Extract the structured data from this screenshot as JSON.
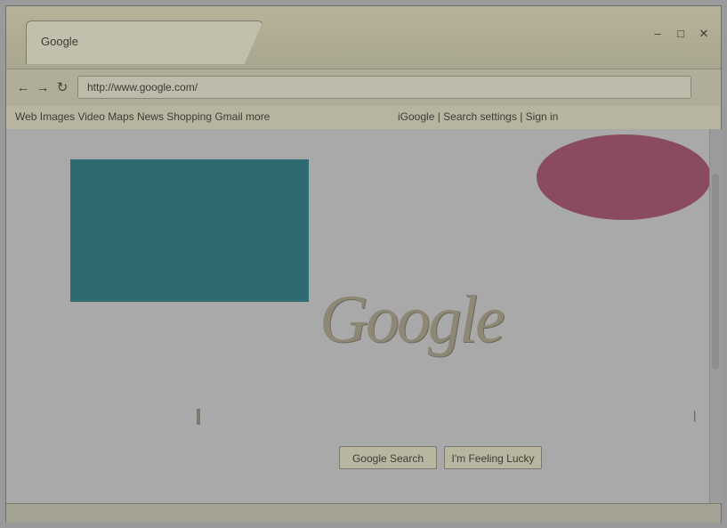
{
  "window": {
    "tab_title": "Google",
    "controls": {
      "minimize": "–",
      "maximize": "□",
      "close": "✕"
    }
  },
  "toolbar": {
    "back_icon": "back-arrow-icon",
    "forward_icon": "forward-arrow-icon",
    "reload_icon": "reload-icon",
    "address": "http://www.google.com/"
  },
  "bookmarks": {
    "left": "Web Images Video Maps News Shopping Gmail more",
    "right": "iGoogle | Search settings | Sign in"
  },
  "page": {
    "logo_text": "Google",
    "search_value": "",
    "buttons": {
      "search": "Google Search",
      "lucky": "I'm Feeling Lucky"
    }
  },
  "colors": {
    "blue_box": "#2f6a70",
    "ellipse": "#8a4a62",
    "chrome": "#b7b39a"
  }
}
